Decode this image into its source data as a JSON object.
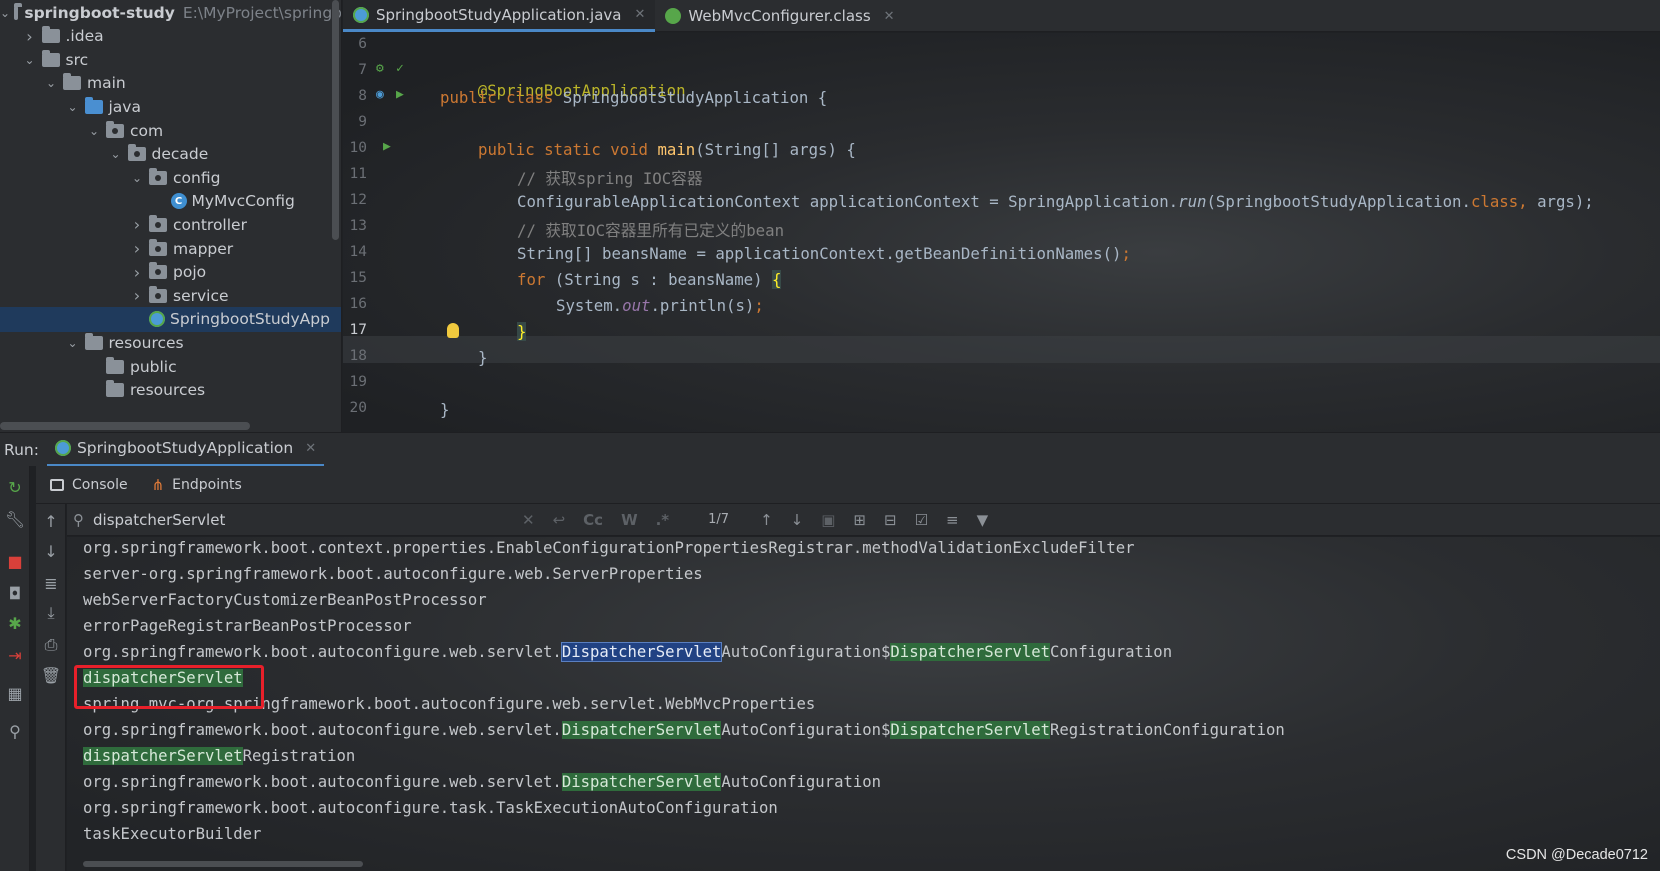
{
  "project": {
    "root_name": "springboot-study",
    "root_path": "E:\\MyProject\\springb",
    "items": [
      {
        "label": ".idea",
        "depth": 1,
        "expanded": false,
        "type": "folder"
      },
      {
        "label": "src",
        "depth": 1,
        "expanded": true,
        "type": "folder"
      },
      {
        "label": "main",
        "depth": 2,
        "expanded": true,
        "type": "folder"
      },
      {
        "label": "java",
        "depth": 3,
        "expanded": true,
        "type": "folder-blue"
      },
      {
        "label": "com",
        "depth": 4,
        "expanded": true,
        "type": "package"
      },
      {
        "label": "decade",
        "depth": 5,
        "expanded": true,
        "type": "package"
      },
      {
        "label": "config",
        "depth": 6,
        "expanded": true,
        "type": "package"
      },
      {
        "label": "MyMvcConfig",
        "depth": 7,
        "type": "class"
      },
      {
        "label": "controller",
        "depth": 6,
        "expanded": false,
        "type": "package"
      },
      {
        "label": "mapper",
        "depth": 6,
        "expanded": false,
        "type": "package"
      },
      {
        "label": "pojo",
        "depth": 6,
        "expanded": false,
        "type": "package"
      },
      {
        "label": "service",
        "depth": 6,
        "expanded": false,
        "type": "package"
      },
      {
        "label": "SpringbootStudyApp",
        "depth": 6,
        "type": "spring-class",
        "selected": true
      },
      {
        "label": "resources",
        "depth": 3,
        "expanded": true,
        "type": "resources"
      },
      {
        "label": "public",
        "depth": 4,
        "type": "folder"
      },
      {
        "label": "resources",
        "depth": 4,
        "type": "folder"
      }
    ]
  },
  "editor": {
    "tabs": [
      {
        "label": "SpringbootStudyApplication.java",
        "active": true
      },
      {
        "label": "WebMvcConfigurer.class",
        "active": false
      }
    ],
    "line_numbers": [
      "6",
      "7",
      "8",
      "9",
      "10",
      "11",
      "12",
      "13",
      "14",
      "15",
      "16",
      "17",
      "18",
      "19",
      "20"
    ],
    "current_line": "17",
    "code": {
      "l7": "@SpringBootApplication",
      "l8_kw": "public class ",
      "l8_name": "SpringbootStudyApplication {",
      "l10_kw": "public static void ",
      "l10_fn": "main",
      "l10_rest": "(String[] args) {",
      "l11": "// 获取spring IOC容器",
      "l12_a": "ConfigurableApplicationContext applicationContext = SpringApplication.",
      "l12_b": "run",
      "l12_c": "(SpringbootStudyApplication.",
      "l12_d": "class",
      "l12_e": ", ",
      "l12_f": "args);",
      "l13": "// 获取IOC容器里所有已定义的bean",
      "l14_a": "String[] beansName = applicationContext.getBeanDefinitionNames()",
      "l14_b": ";",
      "l15_kw": "for ",
      "l15_rest": "(String s : beansName) ",
      "l15_brace": "{",
      "l16_a": "System.",
      "l16_b": "out",
      "l16_c": ".println(s)",
      "l16_d": ";",
      "l17": "}",
      "l18": "}",
      "l20": "}"
    }
  },
  "run": {
    "label": "Run:",
    "tab": "SpringbootStudyApplication",
    "subtabs": [
      "Console",
      "Endpoints"
    ],
    "search": {
      "value": "dispatcherServlet",
      "case_label": "Cc",
      "word_label": "W",
      "regex_label": ".*",
      "match_count": "1/7"
    },
    "console_lines": [
      [
        "org.springframework.boot.context.properties.EnableConfigurationPropertiesRegistrar.methodValidationExcludeFilter"
      ],
      [
        "server-org.springframework.boot.autoconfigure.web.ServerProperties"
      ],
      [
        "webServerFactoryCustomizerBeanPostProcessor"
      ],
      [
        "errorPageRegistrarBeanPostProcessor"
      ],
      [
        "org.springframework.boot.autoconfigure.web.servlet.",
        "DispatcherServlet",
        "AutoConfiguration$",
        "DispatcherServlet",
        "Configuration"
      ],
      [
        "",
        "dispatcherServlet"
      ],
      [
        "spring.mvc-org.springframework.boot.autoconfigure.web.servlet.WebMvcProperties"
      ],
      [
        "org.springframework.boot.autoconfigure.web.servlet.",
        "DispatcherServlet",
        "AutoConfiguration$",
        "DispatcherServlet",
        "RegistrationConfiguration"
      ],
      [
        "",
        "dispatcherServlet",
        "Registration"
      ],
      [
        "org.springframework.boot.autoconfigure.web.servlet.",
        "DispatcherServlet",
        "AutoConfiguration"
      ],
      [
        "org.springframework.boot.autoconfigure.task.TaskExecutionAutoConfiguration"
      ],
      [
        "taskExecutorBuilder"
      ]
    ]
  },
  "watermark": "CSDN @Decade0712"
}
